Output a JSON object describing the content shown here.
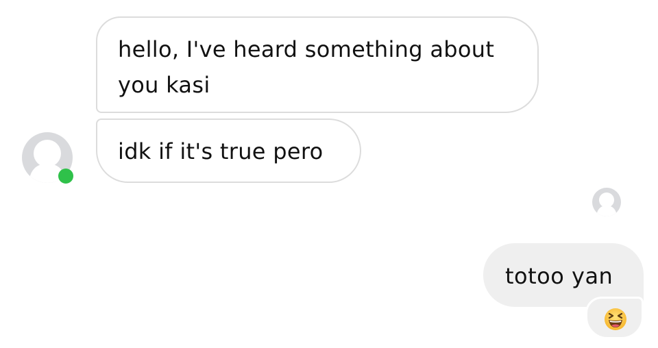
{
  "conversation": {
    "incoming": [
      {
        "text": "hello, I've heard something about you kasi"
      },
      {
        "text": "idk if it's true pero"
      }
    ],
    "outgoing": [
      {
        "text": "totoo yan"
      },
      {
        "emoji": "😆",
        "icon": "laughing-face-icon"
      }
    ]
  },
  "sender": {
    "avatar_icon": "default-person-icon",
    "online": true,
    "online_color": "#2fc14a"
  },
  "read_receipt": {
    "avatar_icon": "default-person-icon"
  }
}
